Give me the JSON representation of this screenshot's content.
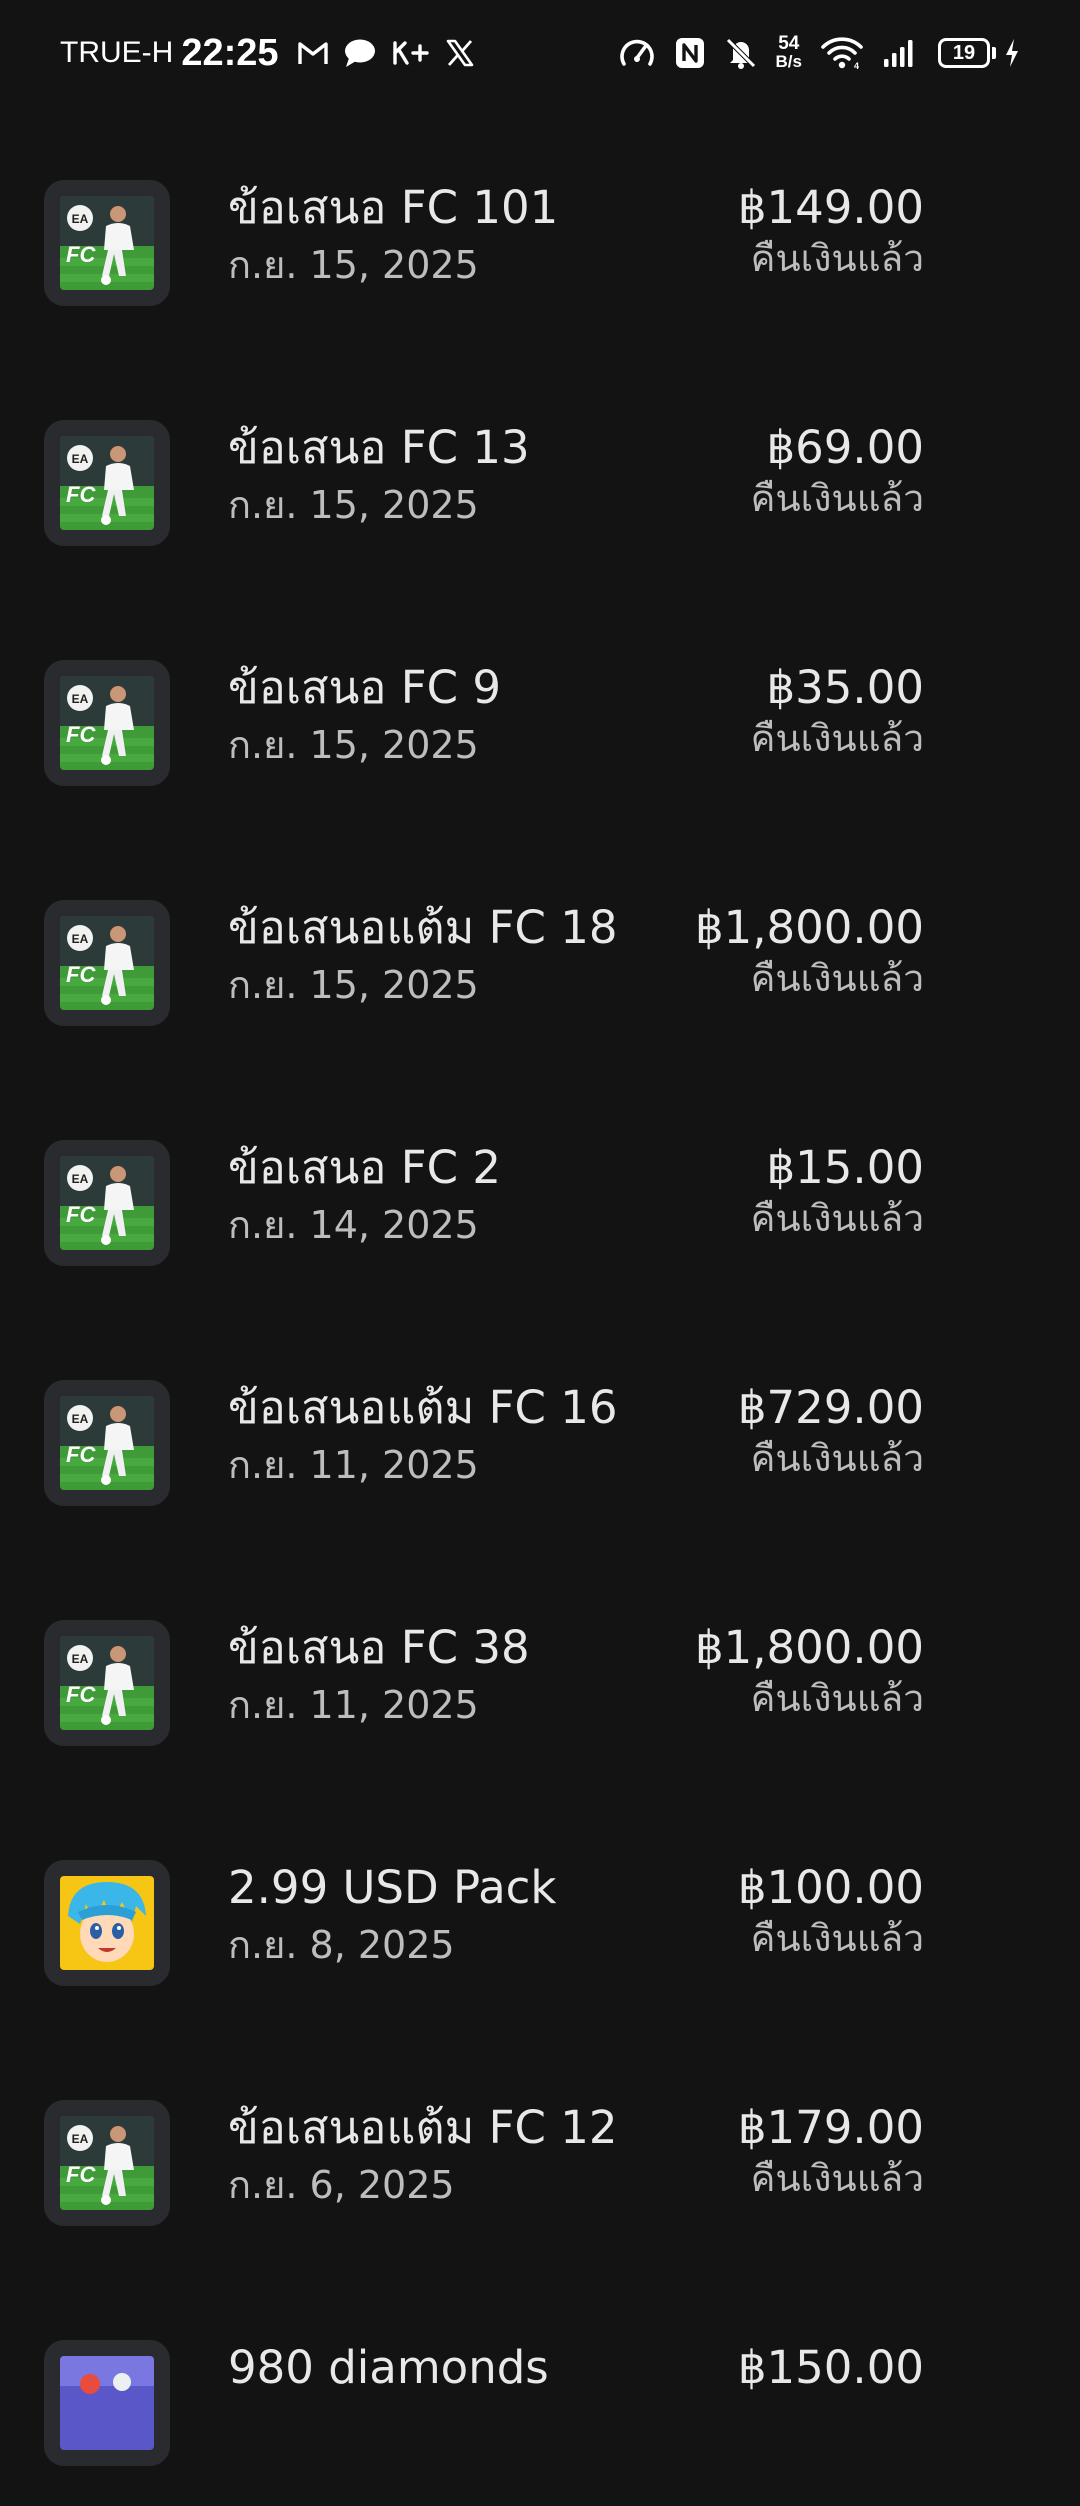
{
  "status_bar": {
    "carrier": "TRUE-H",
    "time": "22:25",
    "net_speed_value": "54",
    "net_speed_unit": "B/s",
    "battery_level": "19",
    "left_icons": [
      "gmail-icon",
      "chat-bubble-icon",
      "kplus-icon",
      "x-icon"
    ],
    "right_icons": [
      "data-saver-icon",
      "nfc-icon",
      "mute-icon",
      "wifi-icon",
      "signal-icon",
      "charging-icon"
    ]
  },
  "purchases": [
    {
      "title": "ข้อเสนอ FC 101",
      "date": "ก.ย. 15, 2025",
      "price": "฿149.00",
      "status": "คืนเงินแล้ว",
      "icon": "fc-game-icon"
    },
    {
      "title": "ข้อเสนอ FC 13",
      "date": "ก.ย. 15, 2025",
      "price": "฿69.00",
      "status": "คืนเงินแล้ว",
      "icon": "fc-game-icon"
    },
    {
      "title": "ข้อเสนอ FC 9",
      "date": "ก.ย. 15, 2025",
      "price": "฿35.00",
      "status": "คืนเงินแล้ว",
      "icon": "fc-game-icon"
    },
    {
      "title": "ข้อเสนอแต้ม FC 18",
      "date": "ก.ย. 15, 2025",
      "price": "฿1,800.00",
      "status": "คืนเงินแล้ว",
      "icon": "fc-game-icon"
    },
    {
      "title": "ข้อเสนอ FC 2",
      "date": "ก.ย. 14, 2025",
      "price": "฿15.00",
      "status": "คืนเงินแล้ว",
      "icon": "fc-game-icon"
    },
    {
      "title": "ข้อเสนอแต้ม FC 16",
      "date": "ก.ย. 11, 2025",
      "price": "฿729.00",
      "status": "คืนเงินแล้ว",
      "icon": "fc-game-icon"
    },
    {
      "title": "ข้อเสนอ FC 38",
      "date": "ก.ย. 11, 2025",
      "price": "฿1,800.00",
      "status": "คืนเงินแล้ว",
      "icon": "fc-game-icon"
    },
    {
      "title": "2.99 USD Pack",
      "date": "ก.ย. 8, 2025",
      "price": "฿100.00",
      "status": "คืนเงินแล้ว",
      "icon": "anime-game-icon"
    },
    {
      "title": "ข้อเสนอแต้ม FC 12",
      "date": "ก.ย. 6, 2025",
      "price": "฿179.00",
      "status": "คืนเงินแล้ว",
      "icon": "fc-game-icon"
    },
    {
      "title": "980 diamonds",
      "date": "",
      "price": "฿150.00",
      "status": "",
      "icon": "diamond-game-icon"
    }
  ]
}
